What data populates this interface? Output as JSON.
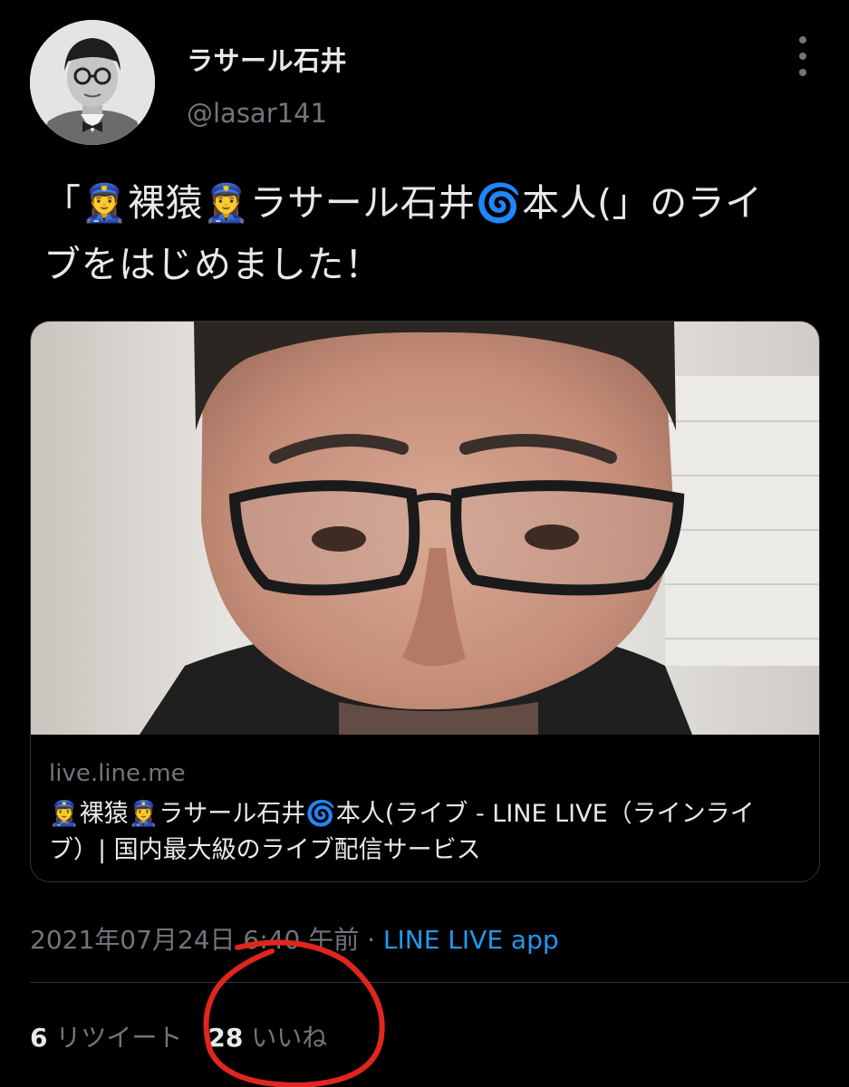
{
  "tweet": {
    "display_name": "ラサール石井",
    "handle": "@lasar141",
    "text_line1": "「👮‍♀️裸猿👮‍♀️ラサール石井🌀本人(」のライ",
    "text_line2": "ブをはじめました！",
    "card": {
      "domain": "live.line.me",
      "title": "👮‍♀️裸猿👮‍♀️ラサール石井🌀本人(ライブ - LINE LIVE（ラインライブ）| 国内最大級のライブ配信サービス"
    },
    "timestamp": "2021年07月24日 6:40 午前",
    "separator": " · ",
    "source": "LINE LIVE app",
    "retweets": {
      "count": "6",
      "label": "リツイート"
    },
    "likes": {
      "count": "28",
      "label": "いいね"
    }
  },
  "colors": {
    "background": "#000000",
    "text_primary": "#e7e9ea",
    "text_secondary": "#71767b",
    "link_blue": "#1d9bf0",
    "annotation_red": "#e0261f"
  },
  "icons": {
    "more_menu": "more-vertical-icon"
  }
}
